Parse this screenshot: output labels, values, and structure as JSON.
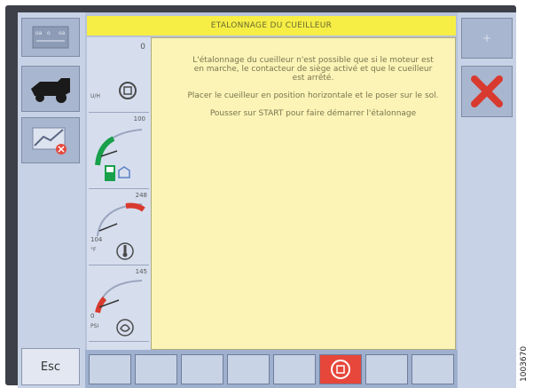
{
  "screen": {
    "title": "ETALONNAGE DU CUEILLEUR",
    "message": {
      "line1": "L'étalonnage du cueilleur n'est possible que si le moteur est en marche, le contacteur de siège activé et que le cueilleur est arrêté.",
      "line2": "Placer le cueilleur en position horizontale et le poser sur le sol.",
      "line3": "Pousser sur START pour faire démarrer l'étalonnage"
    }
  },
  "left_panel": {
    "esc_label": "Esc",
    "icons": [
      "display-settings-icon",
      "combine-icon",
      "header-warning-icon"
    ]
  },
  "gauges": [
    {
      "top_value": "0",
      "unit": "U/H",
      "icon": "engine-icon"
    },
    {
      "top_value": "100",
      "icon": "fuel-icon"
    },
    {
      "top_value": "248",
      "bottom_value": "104",
      "unit": "°F",
      "icon": "coolant-temp-icon"
    },
    {
      "top_value": "145",
      "bottom_value": "0",
      "unit": "PSI",
      "icon": "oil-pressure-icon"
    }
  ],
  "right_panel": {
    "plus_label": "+",
    "icons": [
      "cancel-icon"
    ]
  },
  "bottom_bar": {
    "keys": [
      "empty",
      "empty",
      "empty",
      "empty",
      "empty",
      "engine-start",
      "empty",
      "empty"
    ],
    "active_key": 6
  },
  "colors": {
    "title_bg": "#f6ee45",
    "panel_bg": "#fbf4b6",
    "cancel": "#d93a2f",
    "active_key": "#e7473b",
    "screen_bg": "#b7c3d9"
  },
  "document_number": "1003670"
}
